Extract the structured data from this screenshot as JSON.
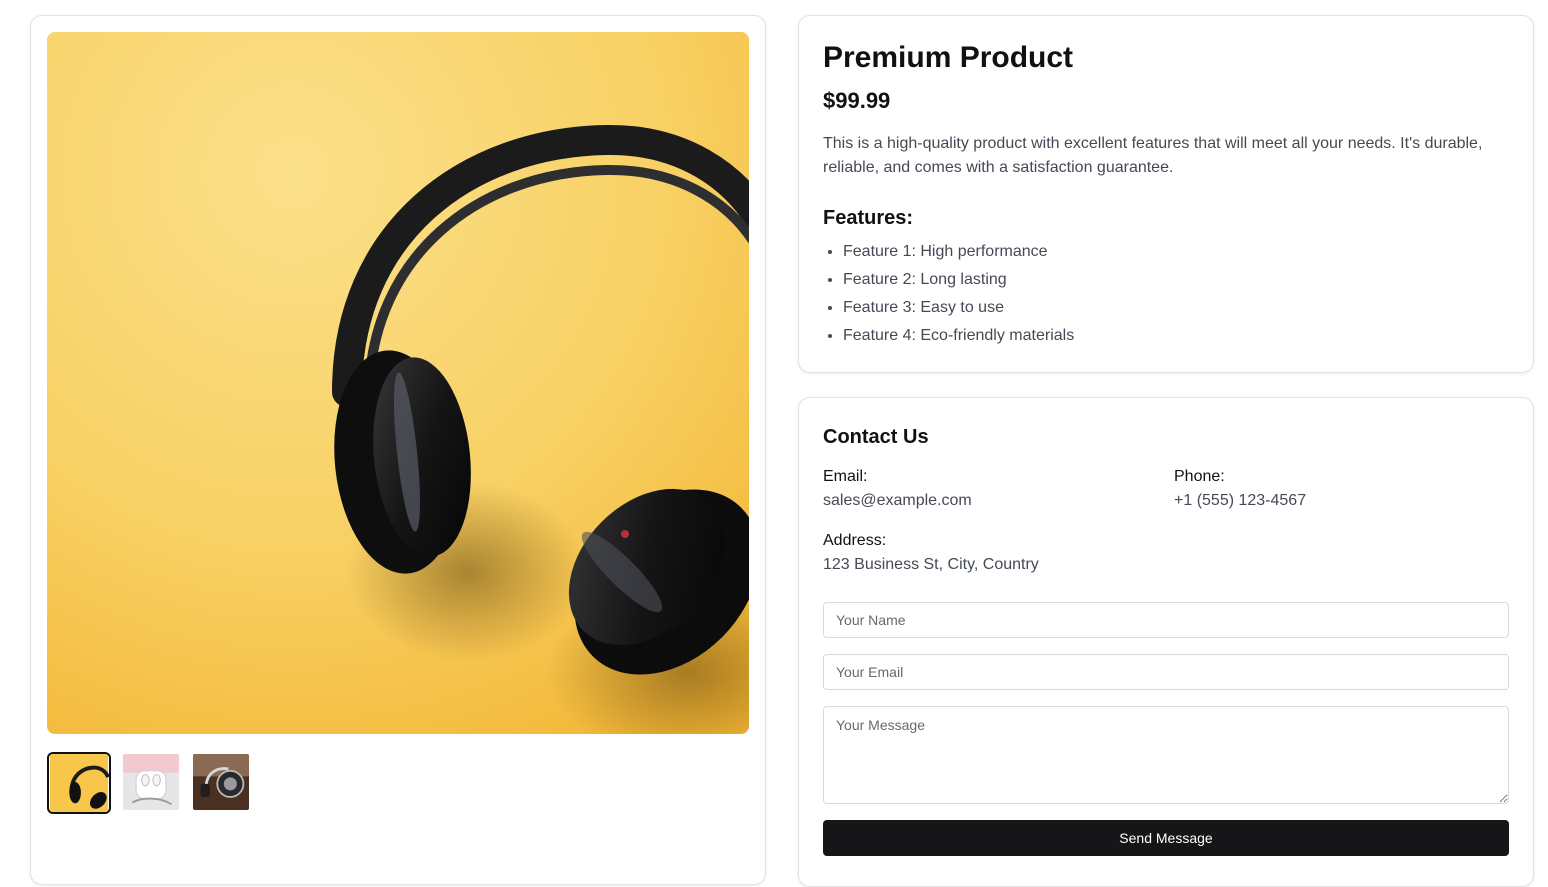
{
  "gallery": {
    "main_image_alt": "",
    "thumbnails": [
      {
        "icon": "headphones-yellow-thumbnail",
        "active": true
      },
      {
        "icon": "earbuds-case-thumbnail",
        "active": false
      },
      {
        "icon": "headphones-brown-thumbnail",
        "active": false
      }
    ]
  },
  "product": {
    "title": "Premium Product",
    "price": "$99.99",
    "description": "This is a high-quality product with excellent features that will meet all your needs. It's durable, reliable, and comes with a satisfaction guarantee.",
    "features_title": "Features:",
    "features": [
      "Feature 1: High performance",
      "Feature 2: Long lasting",
      "Feature 3: Easy to use",
      "Feature 4: Eco-friendly materials"
    ]
  },
  "contact": {
    "title": "Contact Us",
    "email_label": "Email:",
    "email_value": "sales@example.com",
    "phone_label": "Phone:",
    "phone_value": "+1 (555) 123-4567",
    "address_label": "Address:",
    "address_value": "123 Business St, City, Country",
    "form": {
      "name_placeholder": "Your Name",
      "email_placeholder": "Your Email",
      "message_placeholder": "Your Message",
      "submit_label": "Send Message"
    }
  },
  "colors": {
    "image_background": "#f7c64a",
    "button_background": "#161618",
    "text_muted": "#444a55"
  }
}
